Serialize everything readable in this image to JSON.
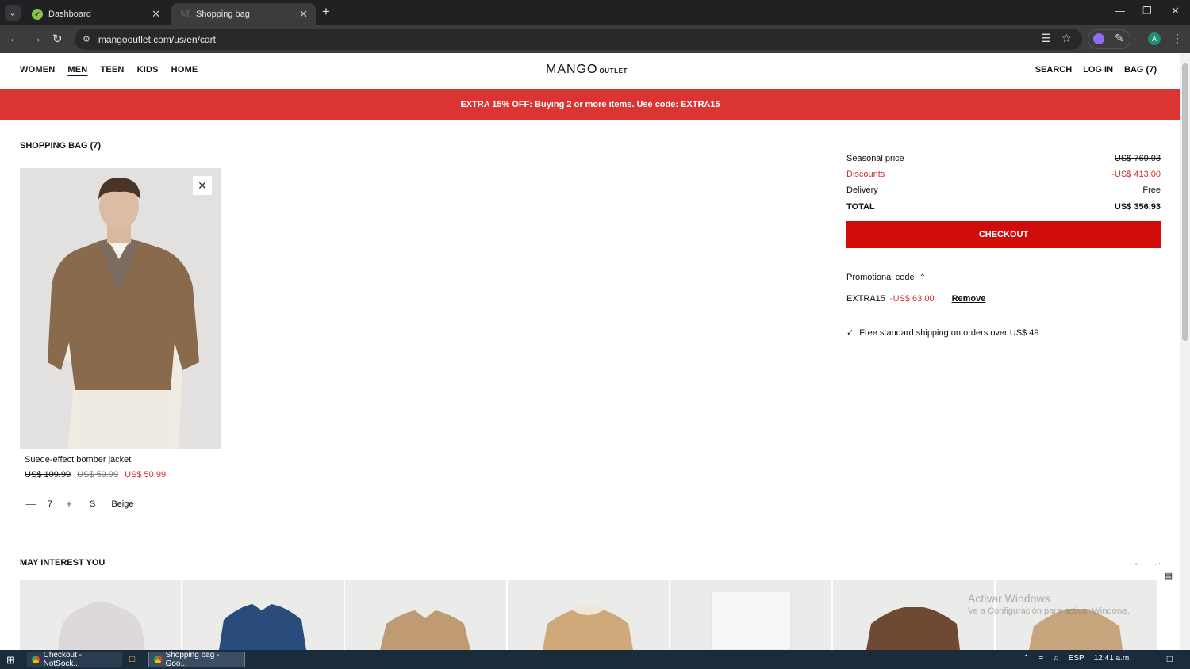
{
  "browser": {
    "tabs": [
      {
        "label": "Dashboard",
        "favicon": "check-circle-icon",
        "active": false
      },
      {
        "label": "Shopping bag",
        "favicon": "mango-m-icon",
        "active": true
      }
    ],
    "url": "mangooutlet.com/us/en/cart",
    "profile_initial": "A"
  },
  "site": {
    "nav": [
      "WOMEN",
      "MEN",
      "TEEN",
      "KIDS",
      "HOME"
    ],
    "active_nav": "MEN",
    "logo_main": "MANGO",
    "logo_sub": "OUTLET",
    "util": {
      "search": "SEARCH",
      "login": "LOG IN",
      "bag": "BAG (7)"
    },
    "promo_banner": "EXTRA 15% OFF: Buying 2 or more items. Use code: EXTRA15",
    "accent_color": "#d10a0a",
    "banner_color": "#dc3333"
  },
  "bag": {
    "title": "SHOPPING BAG (7)",
    "item": {
      "name": "Suede-effect bomber jacket",
      "price_original": "US$ 109.99",
      "price_previous": "US$ 59.99",
      "price_current": "US$ 50.99",
      "quantity": "7",
      "size": "S",
      "color": "Beige"
    }
  },
  "summary": {
    "seasonal_label": "Seasonal price",
    "seasonal_value": "US$ 769.93",
    "discounts_label": "Discounts",
    "discounts_value": "-US$ 413.00",
    "delivery_label": "Delivery",
    "delivery_value": "Free",
    "total_label": "TOTAL",
    "total_value": "US$ 356.93",
    "checkout_label": "CHECKOUT",
    "promo_label": "Promotional code",
    "promo_code": "EXTRA15",
    "promo_discount": "-US$ 63.00",
    "remove_label": "Remove",
    "shipping_note": "Free standard shipping on orders over US$ 49"
  },
  "recommendations": {
    "title": "MAY INTEREST YOU",
    "items": [
      "grey-hoodie",
      "denim-shirt",
      "camel-knit-polo",
      "shearling-collar-jacket",
      "white-jeans",
      "brown-suede-jacket",
      "beige-trench-coat"
    ]
  },
  "watermark": {
    "line1": "Activar Windows",
    "line2": "Ve a Configuración para activar Windows."
  },
  "taskbar": {
    "tasks": [
      "Checkout - NotSock...",
      "Shopping bag - Goo..."
    ],
    "lang": "ESP",
    "time": "12:41 a.m."
  }
}
